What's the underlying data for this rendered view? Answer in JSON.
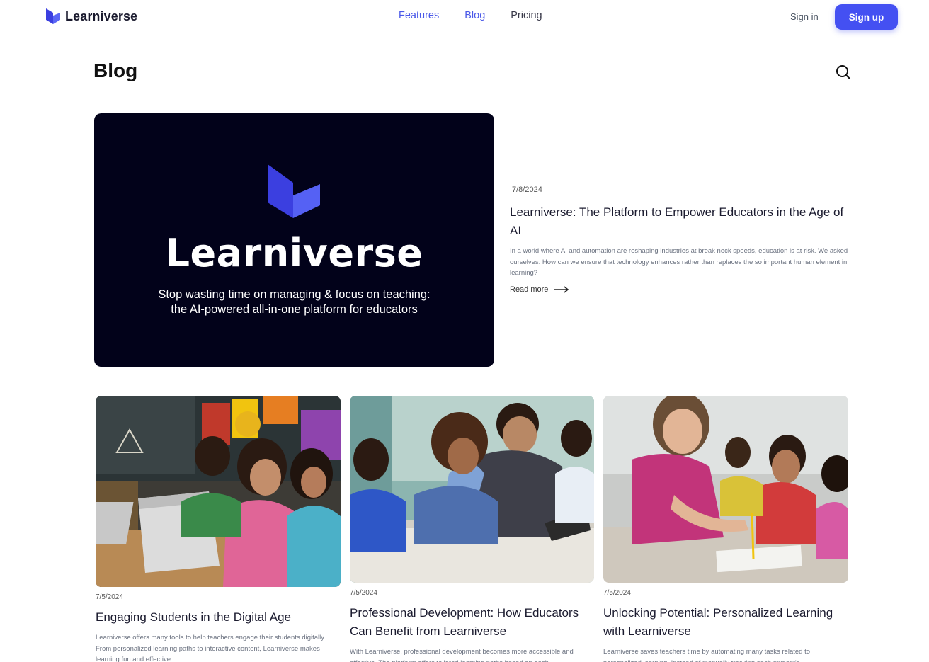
{
  "header": {
    "brand": "Learniverse",
    "nav": [
      {
        "label": "Features",
        "active": true
      },
      {
        "label": "Blog",
        "active": true
      },
      {
        "label": "Pricing",
        "active": false
      }
    ],
    "sign_in": "Sign in",
    "sign_up": "Sign up"
  },
  "page": {
    "title": "Blog",
    "search_icon": "search-icon"
  },
  "featured": {
    "image": {
      "wordmark": "Learniverse",
      "tagline_line1": "Stop wasting time on managing & focus on teaching:",
      "tagline_line2": "the AI-powered all-in-one platform for educators"
    },
    "date": "7/8/2024",
    "title": "Learniverse: The Platform to Empower Educators in the Age of AI",
    "excerpt": "In a world where AI and automation are reshaping industries at break neck speeds, education is at risk. We asked ourselves: How can we ensure that technology enhances rather than replaces the so important human element in learning?",
    "read_more": "Read more"
  },
  "posts": [
    {
      "date": "7/5/2024",
      "title": "Engaging Students in the Digital Age",
      "excerpt": "Learniverse offers many tools to help teachers engage their students digitally. From personalized learning paths to interactive content, Learniverse makes learning fun and effective."
    },
    {
      "date": "7/5/2024",
      "title": "Professional Development: How Educators Can Benefit from Learniverse",
      "excerpt": "With Learniverse, professional development becomes more accessible and effective. The platform offers tailored learning paths based on each"
    },
    {
      "date": "7/5/2024",
      "title": "Unlocking Potential: Personalized Learning with Learniverse",
      "excerpt": "Learniverse saves teachers time by automating many tasks related to personalized learning. Instead of manually tracking each student's"
    }
  ],
  "colors": {
    "accent": "#4450f2",
    "nav_active": "#4a58e8",
    "hero_bg": "#02021a"
  }
}
